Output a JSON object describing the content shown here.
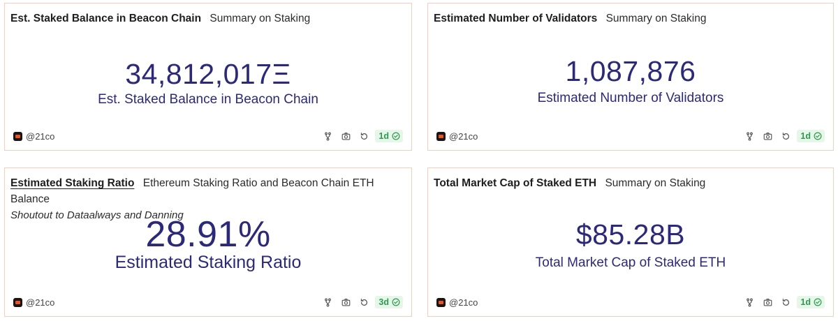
{
  "cards": [
    {
      "title": "Est. Staked Balance in Beacon Chain",
      "subtitle": "Summary on Staking",
      "value": "34,812,017Ξ",
      "value_label": "Est. Staked Balance in Beacon Chain",
      "author": "@21co",
      "freshness": "1d"
    },
    {
      "title": "Estimated Number of Validators",
      "subtitle": "Summary on Staking",
      "value": "1,087,876",
      "value_label": "Estimated Number of Validators",
      "author": "@21co",
      "freshness": "1d"
    },
    {
      "title": "Estimated Staking Ratio",
      "subtitle": "Ethereum Staking Ratio and Beacon Chain ETH Balance",
      "description": "Shoutout to Dataalways and Danning",
      "value": "28.91%",
      "value_label": "Estimated Staking Ratio",
      "author": "@21co",
      "freshness": "3d"
    },
    {
      "title": "Total Market Cap of Staked ETH",
      "subtitle": "Summary on Staking",
      "value": "$85.28B",
      "value_label": "Total Market Cap of Staked ETH",
      "author": "@21co",
      "freshness": "1d"
    }
  ],
  "icons": {
    "fork": "fork-icon",
    "screenshot": "camera-icon",
    "refresh": "refresh-icon",
    "freshness_check": "check-circle-icon"
  },
  "colors": {
    "card_border": "#f3cdbd",
    "value_text": "#2c2a78",
    "badge_bg": "#e6f7ea",
    "badge_text": "#2f9a4f",
    "avatar_accent": "#e8542a"
  }
}
